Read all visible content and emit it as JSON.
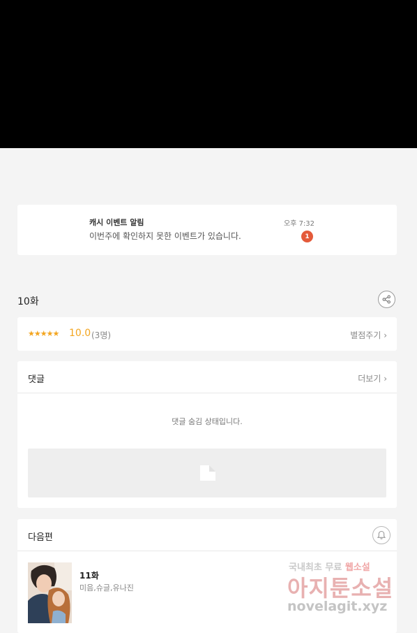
{
  "notification": {
    "title": "캐시 이벤트 알림",
    "message": "이번주에 확인하지 못한 이벤트가 있습니다.",
    "time": "오후 7:32",
    "badge": "1"
  },
  "episode": {
    "title": "10화",
    "share_icon": "share-icon"
  },
  "rating": {
    "stars": "★★★★★",
    "score": "10.0",
    "count": "(3명)",
    "action_label": "별점주기 ›"
  },
  "comments": {
    "title": "댓글",
    "more_label": "더보기 ›",
    "hidden_message": "댓글 숨김 상태입니다."
  },
  "next_episode": {
    "header": "다음편",
    "bell_icon": "bell-icon",
    "title": "11화",
    "authors": "미음,슈글,유나진"
  },
  "watermark": {
    "line1_prefix": "국내최초 무료 ",
    "line1_highlight": "웹소설",
    "line2": "아지툰소설",
    "line3": "novelagit.xyz"
  },
  "colors": {
    "accent": "#f3a51f",
    "badge": "#e45a3a"
  }
}
